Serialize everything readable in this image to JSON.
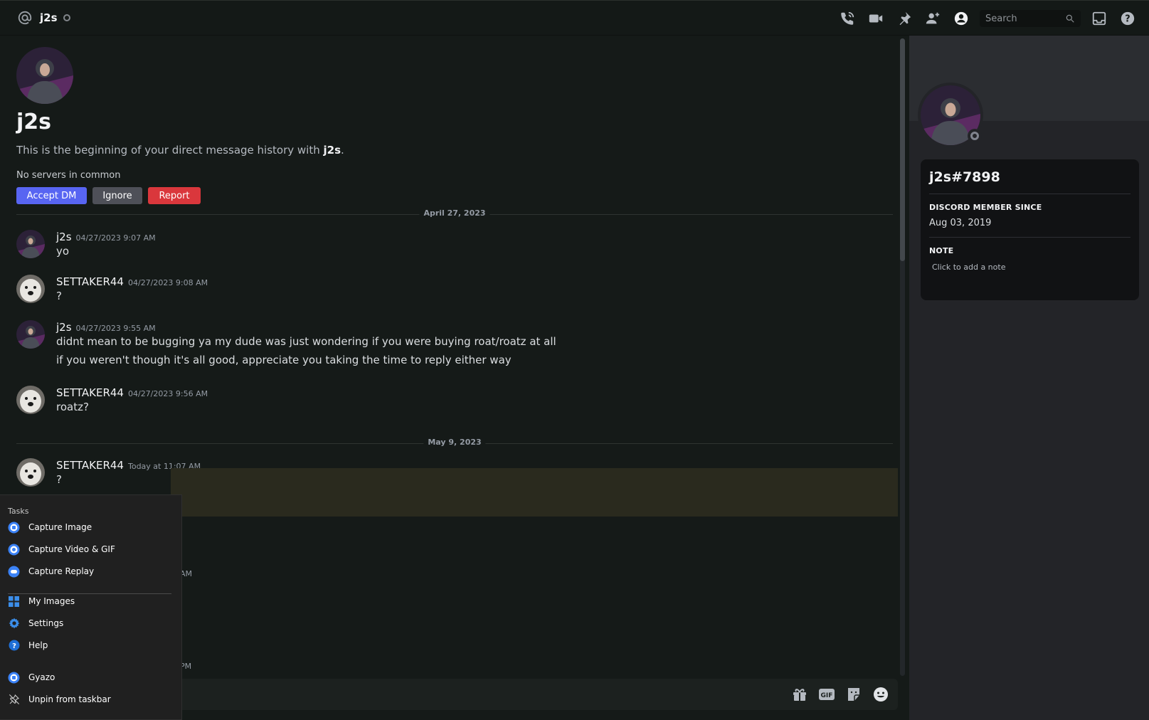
{
  "header": {
    "channel_name": "j2s",
    "search_placeholder": "Search",
    "icons": [
      "phone-call-icon",
      "video-call-icon",
      "pin-icon",
      "add-friend-icon",
      "user-profile-icon",
      "search-icon",
      "inbox-icon",
      "help-icon"
    ]
  },
  "intro": {
    "name": "j2s",
    "text_prefix": "This is the beginning of your direct message history with ",
    "text_name": "j2s",
    "text_suffix": ".",
    "no_servers": "No servers in common",
    "accept_label": "Accept DM",
    "ignore_label": "Ignore",
    "report_label": "Report"
  },
  "dividers": [
    "April 27, 2023",
    "May 9, 2023"
  ],
  "messages": [
    {
      "author": "j2s",
      "time": "04/27/2023 9:07 AM",
      "lines": [
        "yo"
      ]
    },
    {
      "author": "SETTAKER44",
      "time": "04/27/2023 9:08 AM",
      "lines": [
        "?"
      ]
    },
    {
      "author": "j2s",
      "time": "04/27/2023 9:55 AM",
      "lines": [
        "didnt mean to be bugging ya my dude was just wondering if you were buying roat/roatz at all",
        "if you weren't though it's all good, appreciate you taking the time to reply either way"
      ]
    },
    {
      "author": "SETTAKER44",
      "time": "04/27/2023 9:56 AM",
      "lines": [
        "roatz?"
      ]
    },
    {
      "author": "SETTAKER44",
      "time": "Today at 11:07 AM",
      "lines": [
        "?"
      ]
    }
  ],
  "partial_times": [
    "AM",
    "PM"
  ],
  "composer": {
    "icons": [
      "gift-icon",
      "gif-icon",
      "sticker-icon",
      "emoji-icon"
    ],
    "gif_label": "GIF"
  },
  "profile": {
    "username": "j2s#7898",
    "member_since_label": "DISCORD MEMBER SINCE",
    "member_since_value": "Aug 03, 2019",
    "note_label": "NOTE",
    "note_placeholder": "Click to add a note"
  },
  "jumplist": {
    "title": "Tasks",
    "items": [
      {
        "label": "Capture Image",
        "icon": "gyazo-capture-icon"
      },
      {
        "label": "Capture Video & GIF",
        "icon": "gyazo-video-icon"
      },
      {
        "label": "Capture Replay",
        "icon": "gyazo-replay-icon"
      },
      {
        "label": "My Images",
        "icon": "grid-icon"
      },
      {
        "label": "Settings",
        "icon": "gear-icon"
      },
      {
        "label": "Help",
        "icon": "help-icon"
      },
      {
        "label": "Gyazo",
        "icon": "gyazo-app-icon"
      },
      {
        "label": "Unpin from taskbar",
        "icon": "unpin-icon"
      }
    ]
  },
  "colors": {
    "accent": "#5865f2",
    "danger": "#da373c",
    "neutral_button": "#4e5058",
    "background": "#151a18"
  }
}
